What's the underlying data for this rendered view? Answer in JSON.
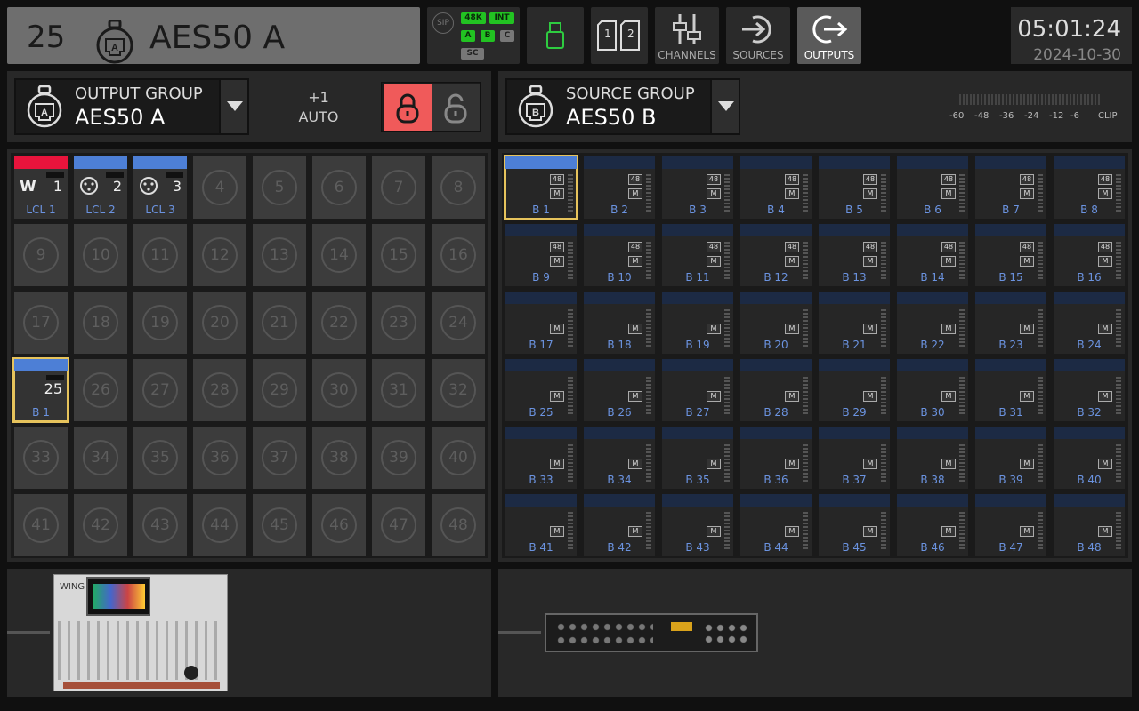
{
  "topbar": {
    "channel_number": "25",
    "channel_name": "AES50 A",
    "sip_label": "SIP",
    "rate_badge": "48K",
    "int_badge": "INT",
    "a_badge": "A",
    "b_badge": "B",
    "c_badge": "C",
    "sc_badge": "SC",
    "card1": "1",
    "card2": "2",
    "channels_label": "CHANNELS",
    "sources_label": "SOURCES",
    "outputs_label": "OUTPUTS",
    "time": "05:01:24",
    "date": "2024-10-30"
  },
  "output_group": {
    "label": "OUTPUT GROUP",
    "name": "AES50 A",
    "step": "+1",
    "mode": "AUTO",
    "icon_letter": "A"
  },
  "source_group": {
    "label": "SOURCE GROUP",
    "name": "AES50 B",
    "icon_letter": "B",
    "meter_scale": [
      "-60",
      "-48",
      "-36",
      "-24",
      "-12",
      "-6",
      "CLIP"
    ]
  },
  "outputs": {
    "assigned": [
      {
        "slot": 1,
        "num": "1",
        "label": "LCL 1",
        "icon": "w-logo-icon",
        "color": "#e8143c"
      },
      {
        "slot": 2,
        "num": "2",
        "label": "LCL 2",
        "icon": "xlr-icon",
        "color": "#4d7fd6"
      },
      {
        "slot": 3,
        "num": "3",
        "label": "LCL 3",
        "icon": "xlr-icon",
        "color": "#4d7fd6"
      },
      {
        "slot": 25,
        "num": "25",
        "label": "B 1",
        "icon": "",
        "color": "#4d7fd6"
      }
    ],
    "slots": [
      "1",
      "2",
      "3",
      "4",
      "5",
      "6",
      "7",
      "8",
      "9",
      "10",
      "11",
      "12",
      "13",
      "14",
      "15",
      "16",
      "17",
      "18",
      "19",
      "20",
      "21",
      "22",
      "23",
      "24",
      "25",
      "26",
      "27",
      "28",
      "29",
      "30",
      "31",
      "32",
      "33",
      "34",
      "35",
      "36",
      "37",
      "38",
      "39",
      "40",
      "41",
      "42",
      "43",
      "44",
      "45",
      "46",
      "47",
      "48"
    ]
  },
  "sources": {
    "labels": [
      "B 1",
      "B 2",
      "B 3",
      "B 4",
      "B 5",
      "B 6",
      "B 7",
      "B 8",
      "B 9",
      "B 10",
      "B 11",
      "B 12",
      "B 13",
      "B 14",
      "B 15",
      "B 16",
      "B 17",
      "B 18",
      "B 19",
      "B 20",
      "B 21",
      "B 22",
      "B 23",
      "B 24",
      "B 25",
      "B 26",
      "B 27",
      "B 28",
      "B 29",
      "B 30",
      "B 31",
      "B 32",
      "B 33",
      "B 34",
      "B 35",
      "B 36",
      "B 37",
      "B 38",
      "B 39",
      "B 40",
      "B 41",
      "B 42",
      "B 43",
      "B 44",
      "B 45",
      "B 46",
      "B 47",
      "B 48"
    ],
    "rate_tag": "48",
    "mute_tag": "M",
    "rows_with_rate": 2
  },
  "devices": {
    "left": "console-device-icon",
    "right": "stagebox-device-icon",
    "wing_text": "WING"
  }
}
